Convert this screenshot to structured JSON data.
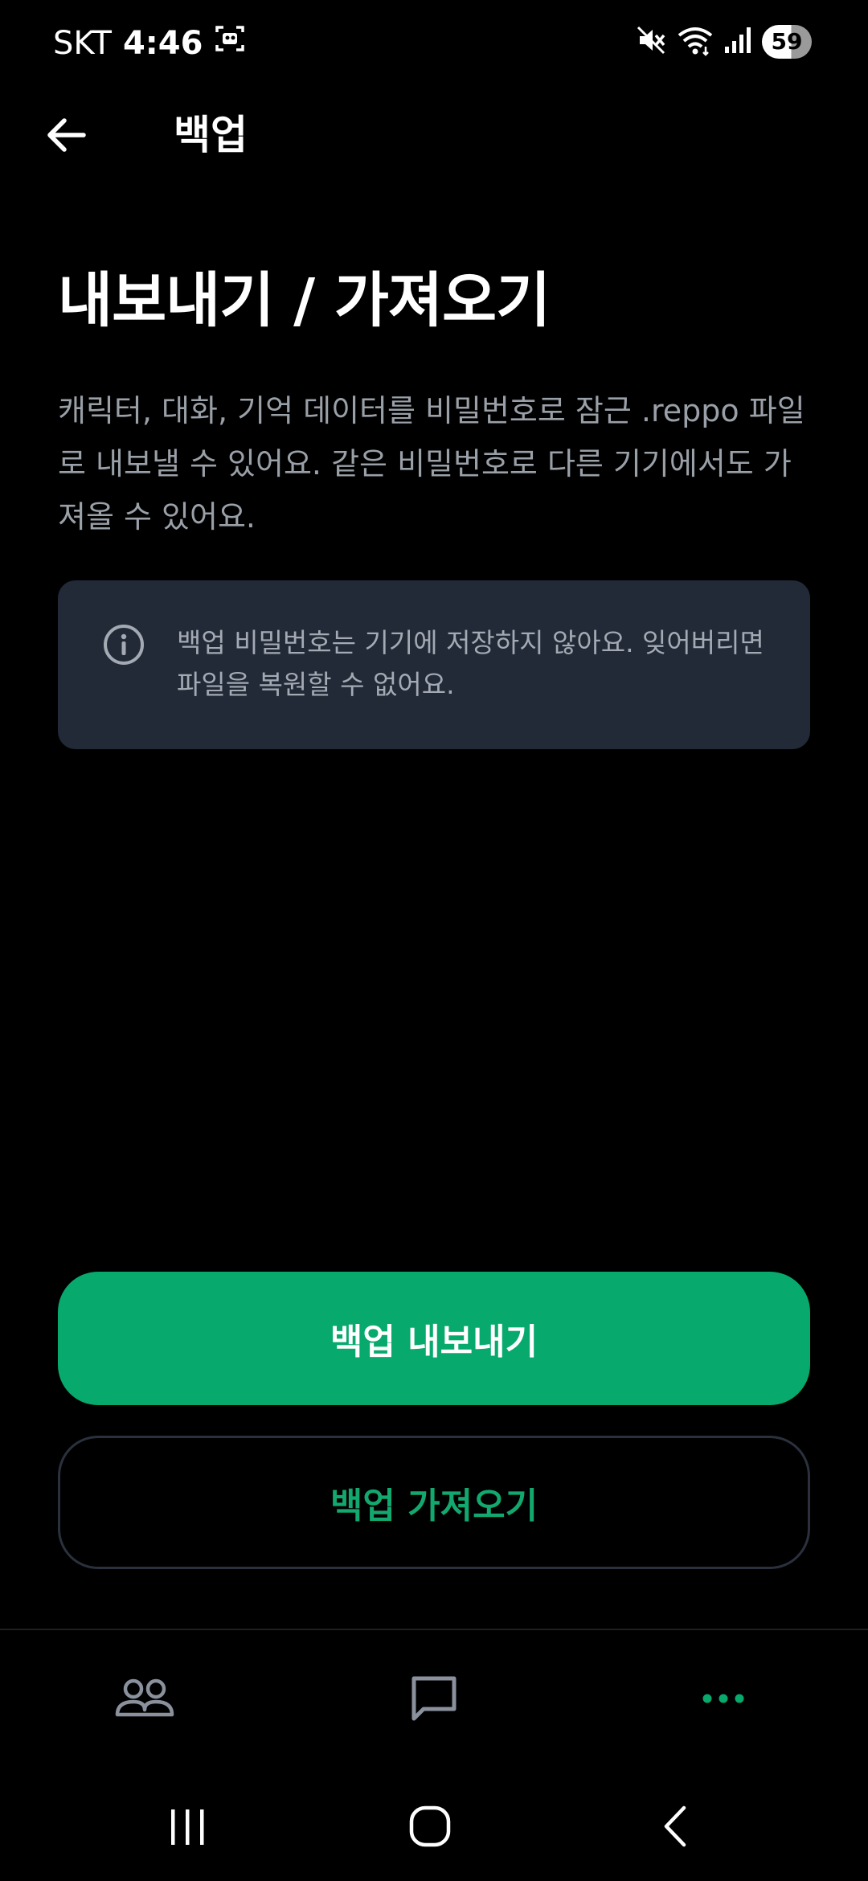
{
  "status_bar": {
    "carrier": "SKT",
    "time": "4:46",
    "battery": "59"
  },
  "app_bar": {
    "title": "백업"
  },
  "main": {
    "heading": "내보내기 / 가져오기",
    "description": "캐릭터, 대화, 기억 데이터를 비밀번호로 잠근 .reppo 파일로 내보낼 수 있어요. 같은 비밀번호로 다른 기기에서도 가져올 수 있어요.",
    "info_text": "백업 비밀번호는 기기에 저장하지 않아요. 잊어버리면 파일을 복원할 수 없어요.",
    "export_label": "백업 내보내기",
    "import_label": "백업 가져오기"
  },
  "bottom_nav": {
    "items": [
      {
        "icon": "people-icon",
        "active": false
      },
      {
        "icon": "chat-icon",
        "active": false
      },
      {
        "icon": "more-icon",
        "active": true
      }
    ]
  },
  "colors": {
    "accent": "#07a96c",
    "background": "#000000",
    "info_box": "#222a38",
    "muted_text": "#9aa0a8",
    "inactive_icon": "#8a919c"
  }
}
